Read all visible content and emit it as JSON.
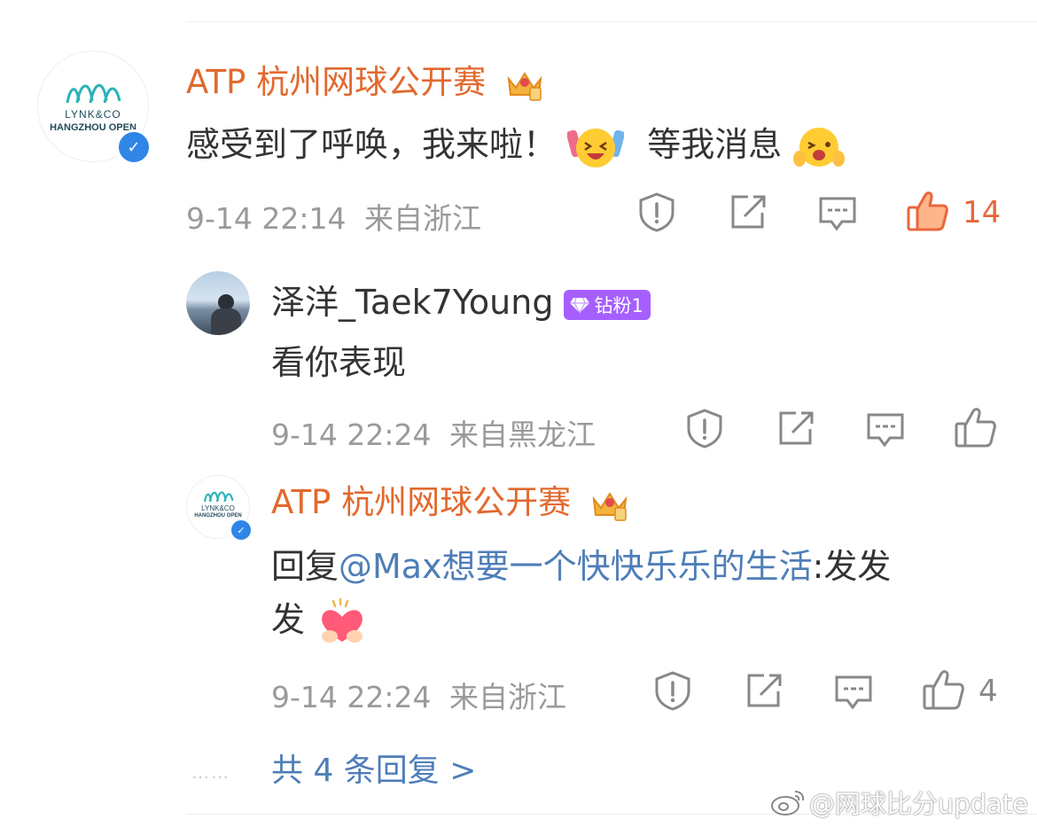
{
  "colors": {
    "accent_name": "#e2692e",
    "like_active": "#e8663d",
    "link": "#4f7eb8",
    "meta_text": "#9a9a9a",
    "badge_bg": "#a55fff",
    "verified": "#2f86e7"
  },
  "comment": {
    "avatar_logo_line1": "LYNK&CO",
    "avatar_logo_line2": "HANGZHOU OPEN",
    "author": "ATP 杭州网球公开赛",
    "author_badge_icon": "crown-icon",
    "text": "感受到了呼唤，我来啦！",
    "text_after_emoji": "等我消息",
    "time": "9-14 22:14",
    "location": "来自浙江",
    "like_count": "14",
    "like_active": true
  },
  "replies": [
    {
      "author": "泽洋_Taek7Young",
      "badge": "钻粉1",
      "text": "看你表现",
      "time": "9-14 22:24",
      "location": "来自黑龙江",
      "like_count": ""
    },
    {
      "avatar_logo_line1": "LYNK&CO",
      "avatar_logo_line2": "HANGZHOU OPEN",
      "author": "ATP 杭州网球公开赛",
      "text_prefix": "回复",
      "mention": "@Max想要一个快快乐乐的生活",
      "text_line1_suffix": ":发发",
      "text_line2": "发",
      "time": "9-14 22:24",
      "location": "来自浙江",
      "like_count": "4"
    }
  ],
  "more_replies": "共 4 条回复 >",
  "more_dots": "……",
  "watermark": "@网球比分update"
}
